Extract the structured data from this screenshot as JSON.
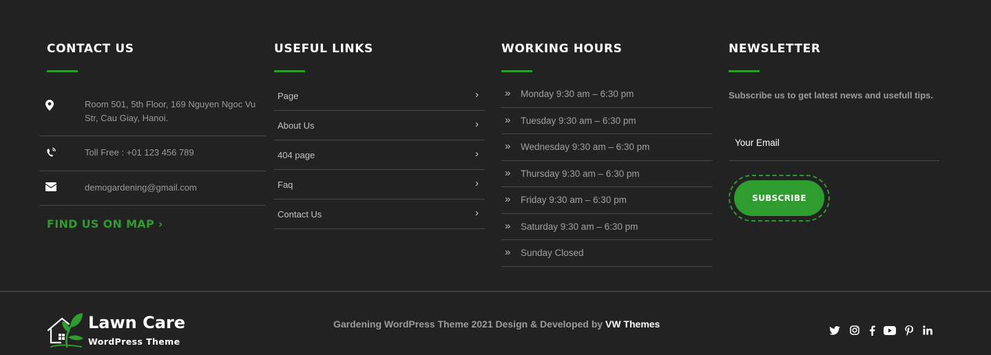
{
  "contact": {
    "heading": "CONTACT US",
    "address": "Room 501, 5th Floor, 169 Nguyen Ngoc Vu Str, Cau Giay, Hanoi.",
    "phone": "Toll Free : +01 123 456 789",
    "email": "demogardening@gmail.com",
    "map_link": "FIND US ON MAP",
    "map_link_arrow": "›"
  },
  "useful_links": {
    "heading": "USEFUL LINKS",
    "chevron": "›",
    "items": [
      "Page",
      "About Us",
      "404 page",
      "Faq",
      "Contact Us"
    ]
  },
  "working_hours": {
    "heading": "WORKING HOURS",
    "bullet": "»",
    "items": [
      "Monday 9:30 am – 6:30 pm",
      "Tuesday 9:30 am – 6:30 pm",
      "Wednesday 9:30 am – 6:30 pm",
      "Thursday 9:30 am – 6:30 pm",
      "Friday 9:30 am – 6:30 pm",
      "Saturday 9:30 am – 6:30 pm",
      "Sunday Closed"
    ]
  },
  "newsletter": {
    "heading": "NEWSLETTER",
    "text": "Subscribe us to get latest news and usefull tips.",
    "email_placeholder": "Your Email",
    "subscribe_label": "SUBSCRIBE"
  },
  "footer": {
    "logo_name": "Lawn Care",
    "logo_sub": "WordPress Theme",
    "copyright_text": "Gardening WordPress Theme 2021 Design & Developed by ",
    "copyright_brand": "VW Themes",
    "social": [
      "twitter-icon",
      "instagram-icon",
      "facebook-icon",
      "youtube-icon",
      "pinterest-icon",
      "linkedin-icon"
    ]
  },
  "colors": {
    "background": "#222222",
    "accent": "#2e9c2f",
    "divider": "#4a4a4a",
    "text": "#a7a7a7",
    "heading": "#ffffff"
  }
}
